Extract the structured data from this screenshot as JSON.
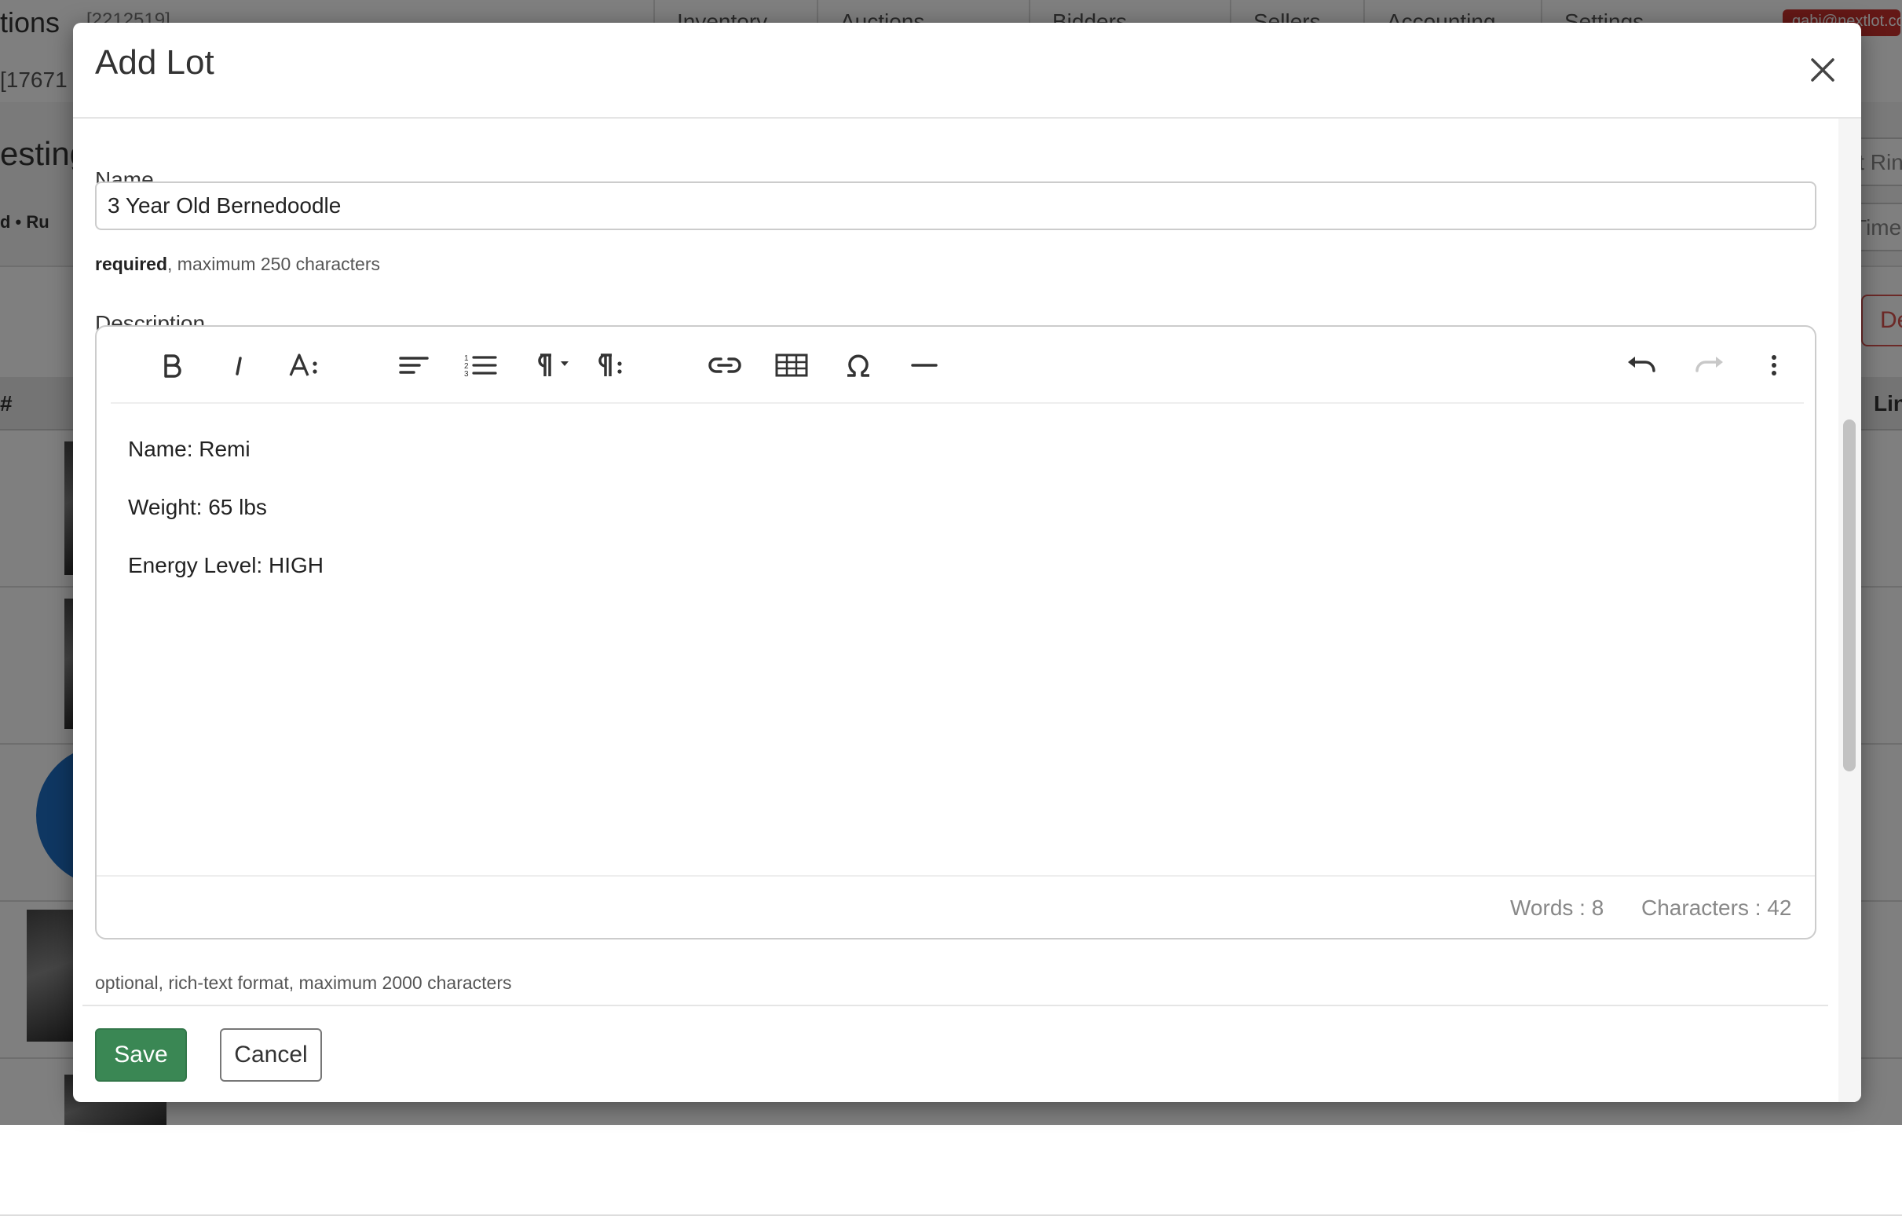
{
  "background": {
    "brand": "tions",
    "header_id": "[2212519]",
    "nav": [
      "Inventory",
      "Auctions",
      "Bidders",
      "Sellers",
      "Accounting",
      "Settings"
    ],
    "email": "gabi@nextlot.com",
    "sub_id": "[17671",
    "page_title": "esting",
    "meta": "d • Ru",
    "right_btn_1": "it Rin",
    "right_btn_2": "Time",
    "delete_btn": "De",
    "col_hash": "#",
    "col_lin": "Lin"
  },
  "modal": {
    "title": "Add Lot",
    "name_label": "Name",
    "name_value": "3 Year Old Bernedoodle",
    "name_help_strong": "required",
    "name_help_rest": ", maximum 250 characters",
    "description_label": "Description",
    "description_lines": [
      "Name: Remi",
      "Weight: 65 lbs",
      "Energy Level: HIGH"
    ],
    "words_label": "Words : 8",
    "characters_label": "Characters : 42",
    "description_help": "optional, rich-text format, maximum 2000 characters",
    "save_label": "Save",
    "cancel_label": "Cancel"
  },
  "toolbar_icons": [
    "bold-icon",
    "italic-icon",
    "font-size-icon",
    "align-icon",
    "ordered-list-icon",
    "paragraph-format-icon",
    "paragraph-style-icon",
    "link-icon",
    "table-icon",
    "special-characters-icon",
    "horizontal-line-icon",
    "undo-icon",
    "redo-icon",
    "more-options-icon"
  ],
  "colors": {
    "save_button": "#3a8754",
    "overlay": "rgba(0,0,0,0.5)",
    "delete_button": "#d9534f"
  }
}
